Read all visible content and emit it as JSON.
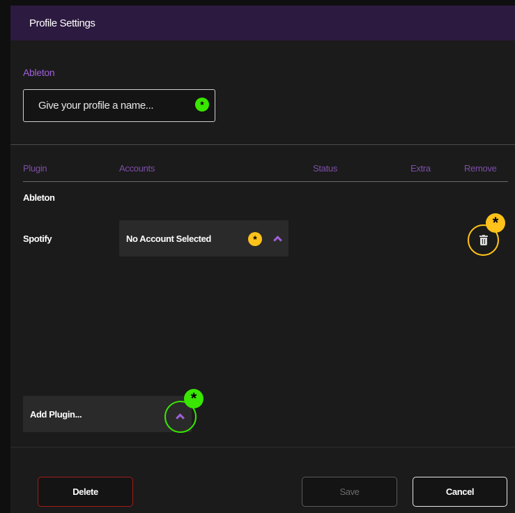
{
  "dialog": {
    "title": "Profile Settings"
  },
  "profile": {
    "section_label": "Ableton",
    "name_placeholder": "Give your profile a name..."
  },
  "table": {
    "columns": [
      "Plugin",
      "Accounts",
      "Status",
      "Extra",
      "Remove"
    ],
    "group_label": "Ableton",
    "rows": [
      {
        "plugin": "Spotify",
        "account": "No Account Selected"
      }
    ]
  },
  "add_plugin": {
    "label": "Add Plugin..."
  },
  "footer": {
    "delete_label": "Delete",
    "save_label": "Save",
    "cancel_label": "Cancel"
  },
  "annotations": {
    "marker_symbol": "*",
    "green": "#39e600",
    "yellow": "#ffc21a"
  },
  "colors": {
    "accent": "#a05fd8",
    "title_bar": "#2d1a40",
    "delete_border": "#a31b1b"
  },
  "icons": {
    "remove": "trash-icon",
    "dropdown": "chevron-up-icon"
  }
}
